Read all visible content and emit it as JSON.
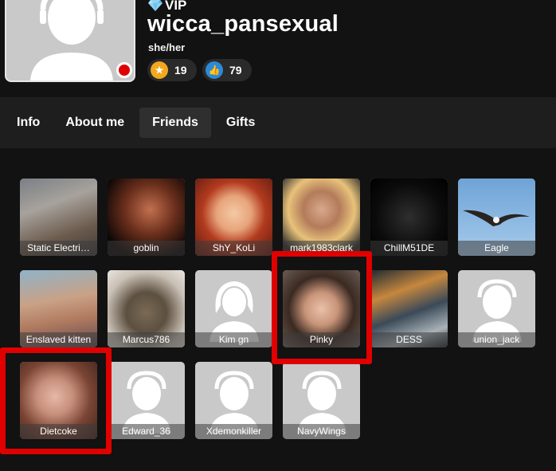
{
  "profile": {
    "vip_label": "VIP",
    "username": "wicca_pansexual",
    "pronouns": "she/her",
    "stars_count": "19",
    "likes_count": "79",
    "status_color": "#e10000",
    "vip_icon": "diamond-icon"
  },
  "tabs": [
    {
      "label": "Info"
    },
    {
      "label": "About me"
    },
    {
      "label": "Friends"
    },
    {
      "label": "Gifts"
    }
  ],
  "active_tab": "Friends",
  "friends": [
    {
      "name": "Static Electri…"
    },
    {
      "name": "goblin"
    },
    {
      "name": "ShY_KoLi"
    },
    {
      "name": "mark1983clark"
    },
    {
      "name": "ChillM51DE"
    },
    {
      "name": "Eagle"
    },
    {
      "name": "Enslaved kitten"
    },
    {
      "name": "Marcus786"
    },
    {
      "name": "Kim gn"
    },
    {
      "name": "Pinky"
    },
    {
      "name": "DESS"
    },
    {
      "name": "union_jack"
    },
    {
      "name": "Dietcoke"
    },
    {
      "name": "Edward_36"
    },
    {
      "name": "Xdemonkiller"
    },
    {
      "name": "NavyWings"
    }
  ],
  "highlight_color": "#e00000"
}
